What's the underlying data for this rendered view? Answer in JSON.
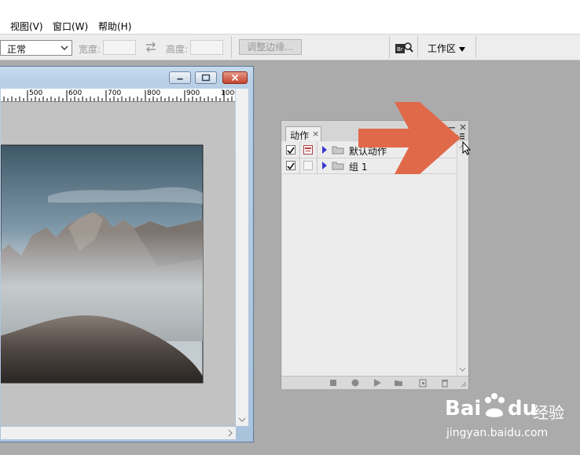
{
  "menu": {
    "items": [
      {
        "label": "视图(V)"
      },
      {
        "label": "窗口(W)"
      },
      {
        "label": "帮助(H)"
      }
    ]
  },
  "options": {
    "mode_value": "正常",
    "width_label": "宽度:",
    "height_label": "高度:",
    "refine_button": "调整边缘...",
    "workspace_label": "工作区"
  },
  "document": {
    "ruler_labels": [
      "500",
      "600",
      "700",
      "800",
      "900",
      "1000"
    ]
  },
  "actions_panel": {
    "tab_label": "动作",
    "tab_close": "×",
    "rows": [
      {
        "label": "默认动作",
        "checked": true,
        "dialog_on": true
      },
      {
        "label": "组 1",
        "checked": true,
        "dialog_on": false
      }
    ]
  },
  "watermark": {
    "brand_left": "Bai",
    "brand_right": "du",
    "brand_cn": "经验",
    "url": "jingyan.baidu.com"
  },
  "colors": {
    "arrow": "#e0694a",
    "workspace_bg": "#ababab",
    "close_button": "#c4432c"
  }
}
